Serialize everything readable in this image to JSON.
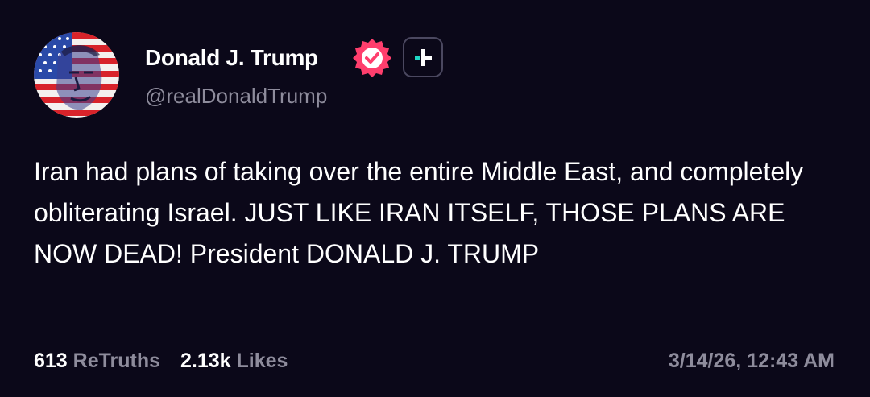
{
  "author": {
    "display_name": "Donald J. Trump",
    "handle": "@realDonaldTrump",
    "avatar_icon": "flag-portrait-avatar",
    "verified_icon": "verified-badge-icon",
    "plus_icon": "plus-badge-icon"
  },
  "post": {
    "text": "Iran had plans of taking over the entire Middle East, and completely obliterating Israel. JUST LIKE IRAN ITSELF, THOSE PLANS ARE NOW DEAD! President DONALD J. TRUMP",
    "timestamp": "3/14/26, 12:43 AM"
  },
  "stats": {
    "retruths_count": "613",
    "retruths_label": "ReTruths",
    "likes_count": "2.13k",
    "likes_label": "Likes"
  },
  "colors": {
    "background": "#0b0819",
    "text_primary": "#ffffff",
    "text_secondary": "#8e8c9c",
    "verified_badge": "#ff3e6d",
    "plus_accent": "#1fd6c5"
  }
}
